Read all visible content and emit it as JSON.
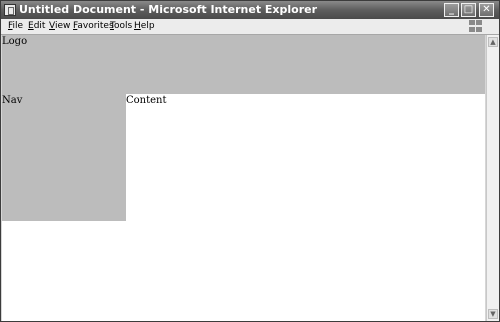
{
  "window": {
    "title": "Untitled Document - Microsoft Internet Explorer",
    "controls": {
      "minimize": "_",
      "maximize": "□",
      "close": "✕"
    }
  },
  "menu": {
    "items": [
      {
        "label": "File"
      },
      {
        "label": "Edit"
      },
      {
        "label": "View"
      },
      {
        "label": "Favorites"
      },
      {
        "label": "Tools"
      },
      {
        "label": "Help"
      }
    ]
  },
  "page": {
    "logo_text": "Logo",
    "nav_text": "Nav",
    "content_text": "Content"
  },
  "scrollbar": {
    "up": "▲",
    "down": "▼"
  },
  "colors": {
    "block_gray": "#bcbcbc",
    "titlebar": "#5e5e5e"
  }
}
